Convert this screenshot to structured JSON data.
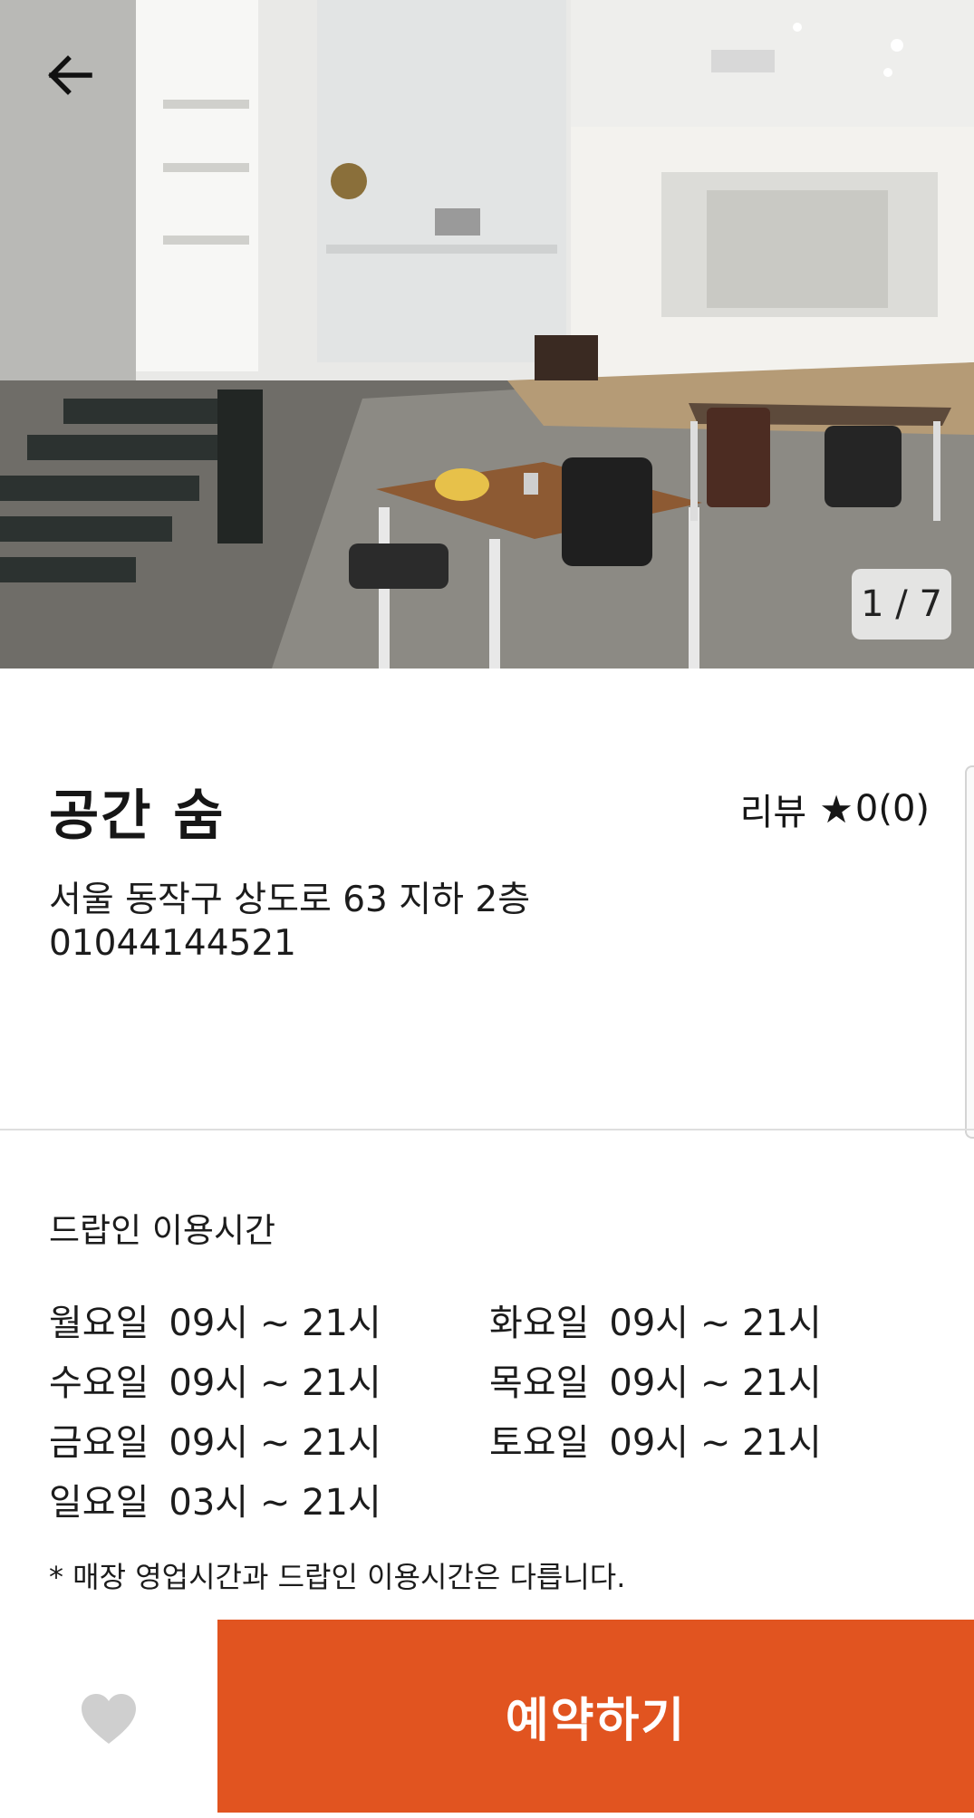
{
  "gallery": {
    "counter": "1 / 7",
    "back_icon": "arrow-left-icon"
  },
  "place": {
    "name": "공간 숨",
    "review_label": "리뷰",
    "review_score": "0(0)",
    "address": "서울 동작구 상도로 63 지하 2층",
    "phone": "01044144521"
  },
  "hours": {
    "title": "드랍인 이용시간",
    "days": [
      {
        "day": "월요일",
        "time": "09시 ~ 21시"
      },
      {
        "day": "화요일",
        "time": "09시 ~ 21시"
      },
      {
        "day": "수요일",
        "time": "09시 ~ 21시"
      },
      {
        "day": "목요일",
        "time": "09시 ~ 21시"
      },
      {
        "day": "금요일",
        "time": "09시 ~ 21시"
      },
      {
        "day": "토요일",
        "time": "09시 ~ 21시"
      },
      {
        "day": "일요일",
        "time": "03시 ~ 21시"
      }
    ],
    "note": "* 매장 영업시간과 드랍인 이용시간은 다릅니다."
  },
  "actions": {
    "reserve_label": "예약하기",
    "favorite_icon": "heart-icon"
  },
  "colors": {
    "accent": "#e15420",
    "heart": "#cfcfcf"
  }
}
